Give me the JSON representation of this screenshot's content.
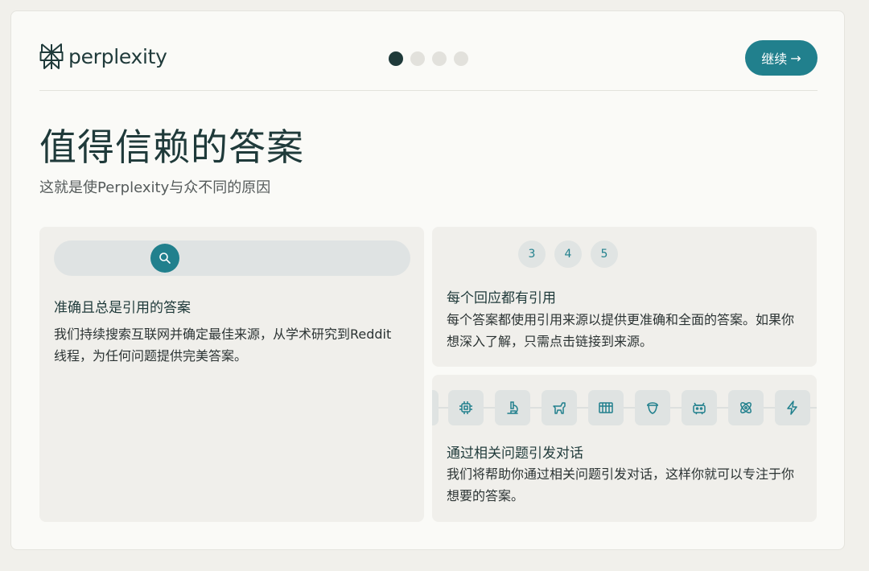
{
  "brand": {
    "name": "perplexity"
  },
  "header": {
    "continue_label": "继续",
    "continue_arrow": "→",
    "progress": {
      "total": 4,
      "current": 1
    }
  },
  "hero": {
    "title": "值得信赖的答案",
    "subtitle": "这就是使Perplexity与众不同的原因"
  },
  "cards": {
    "accurate": {
      "title": "准确且总是引用的答案",
      "description": "我们持续搜索互联网并确定最佳来源，从学术研究到Reddit线程，为任何问题提供完美答案。"
    },
    "citations": {
      "numbers": [
        "3",
        "4",
        "5"
      ],
      "title": "每个回应都有引用",
      "description": "每个答案都使用引用来源以提供更准确和全面的答案。如果你想深入了解，只需点击链接到来源。"
    },
    "related": {
      "icons": [
        "chip-icon",
        "microscope-icon",
        "dog-icon",
        "film-icon",
        "acorn-icon",
        "robot-icon",
        "atom-icon",
        "lightning-icon"
      ],
      "title": "通过相关问题引发对话",
      "description": "我们将帮助你通过相关问题引发对话，这样你就可以专注于你想要的答案。"
    }
  },
  "colors": {
    "accent": "#21808d",
    "text": "#1f3a3a",
    "card": "#f0efeb",
    "background": "#fafaf7"
  }
}
